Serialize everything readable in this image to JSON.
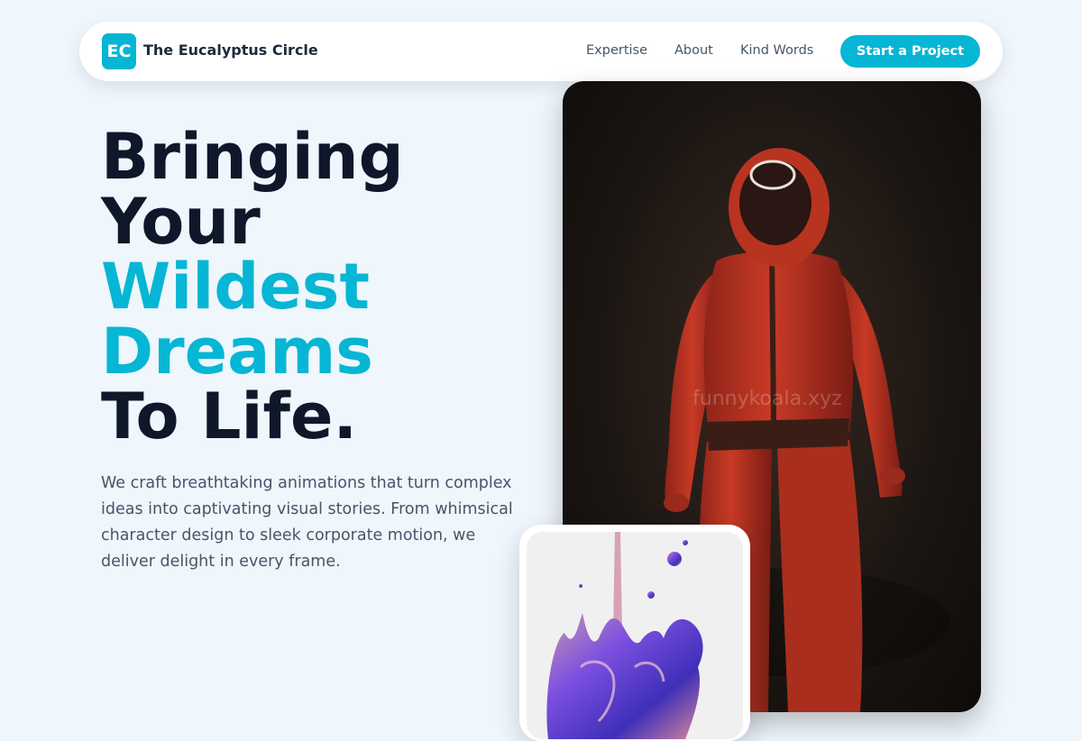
{
  "nav": {
    "logo_initials": "EC",
    "brand_name": "The Eucalyptus Circle",
    "links": [
      "Expertise",
      "About",
      "Kind Words"
    ],
    "cta_label": "Start a Project"
  },
  "hero": {
    "title_lines": [
      "Bringing",
      "Your",
      "Wildest",
      "Dreams",
      "To Life."
    ],
    "description": "We craft breathtaking animations that turn complex ideas into captivating visual stories. From whimsical character design to sleek corporate motion, we deliver delight in every frame."
  },
  "visuals": {
    "main_watermark": "funnykoala.xyz"
  },
  "colors": {
    "accent": "#06b6d4",
    "heading": "#0f172a",
    "body_text": "#475569",
    "page_background": "#eff6fc"
  },
  "icons": {
    "logo": "logo-icon"
  }
}
